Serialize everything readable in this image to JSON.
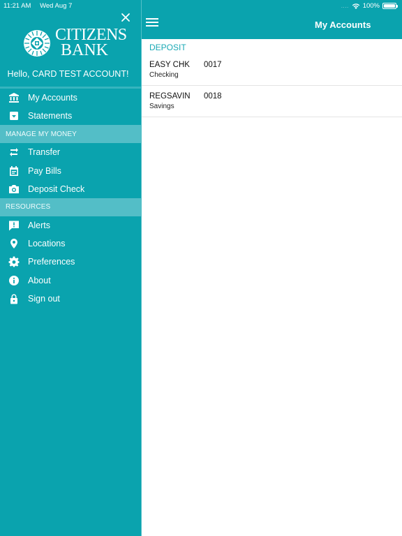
{
  "status_bar": {
    "time": "11:21 AM",
    "date": "Wed Aug 7",
    "signal": "....",
    "battery": "100%",
    "battery_level": 1.0
  },
  "sidebar": {
    "logo_line1": "CITIZENS",
    "logo_line2": "BANK",
    "greeting": "Hello, CARD TEST ACCOUNT!",
    "items_top": [
      {
        "label": "My Accounts",
        "icon": "bank-icon"
      },
      {
        "label": "Statements",
        "icon": "statements-icon"
      }
    ],
    "section_money": "MANAGE MY MONEY",
    "items_money": [
      {
        "label": "Transfer",
        "icon": "transfer-icon"
      },
      {
        "label": "Pay Bills",
        "icon": "calendar-icon"
      },
      {
        "label": "Deposit Check",
        "icon": "camera-icon"
      }
    ],
    "section_resources": "RESOURCES",
    "items_resources": [
      {
        "label": "Alerts",
        "icon": "alert-icon"
      },
      {
        "label": "Locations",
        "icon": "location-pin-icon"
      },
      {
        "label": "Preferences",
        "icon": "gear-icon"
      },
      {
        "label": "About",
        "icon": "info-icon"
      },
      {
        "label": "Sign out",
        "icon": "lock-icon"
      }
    ]
  },
  "navbar": {
    "title": "My Accounts"
  },
  "main": {
    "group_header": "DEPOSIT",
    "accounts": [
      {
        "nickname": "EASY CHK",
        "number": "0017",
        "type": "Checking"
      },
      {
        "nickname": "REGSAVIN",
        "number": "0018",
        "type": "Savings"
      }
    ]
  },
  "colors": {
    "brand_teal": "#0aa3ae",
    "section_header": "#53bec7",
    "group_header_text": "#1aa9b5"
  }
}
